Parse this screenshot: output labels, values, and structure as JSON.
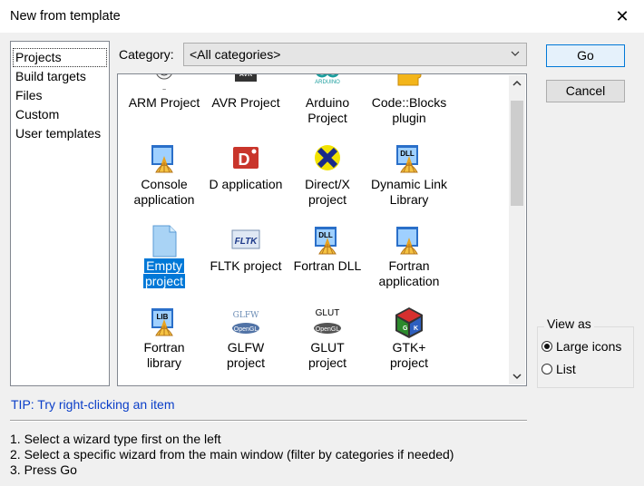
{
  "window": {
    "title": "New from template",
    "close_glyph": "✕"
  },
  "left_list": {
    "items": [
      "Projects",
      "Build targets",
      "Files",
      "Custom",
      "User templates"
    ],
    "selected_index": 0
  },
  "category": {
    "label": "Category:",
    "value": "<All categories>"
  },
  "templates": [
    {
      "label_lines": [
        "ARM Project"
      ],
      "icon": "arm-icon"
    },
    {
      "label_lines": [
        "AVR Project"
      ],
      "icon": "avr-chip-icon"
    },
    {
      "label_lines": [
        "Arduino",
        "Project"
      ],
      "icon": "arduino-icon",
      "icon_text": "ARDUINO"
    },
    {
      "label_lines": [
        "Code::Blocks",
        "plugin"
      ],
      "icon": "puzzle-icon"
    },
    {
      "label_lines": [
        "Console",
        "application"
      ],
      "icon": "console-app-icon"
    },
    {
      "label_lines": [
        "D application"
      ],
      "icon": "d-app-icon",
      "icon_text": "D"
    },
    {
      "label_lines": [
        "Direct/X",
        "project"
      ],
      "icon": "directx-icon"
    },
    {
      "label_lines": [
        "Dynamic Link",
        "Library"
      ],
      "icon": "dll-icon",
      "icon_text": "DLL"
    },
    {
      "label_lines": [
        "Empty",
        "project"
      ],
      "icon": "empty-file-icon",
      "selected": true
    },
    {
      "label_lines": [
        "FLTK project"
      ],
      "icon": "fltk-icon",
      "icon_text": "FLTK"
    },
    {
      "label_lines": [
        "Fortran DLL"
      ],
      "icon": "fortran-dll-icon",
      "icon_text": "DLL"
    },
    {
      "label_lines": [
        "Fortran",
        "application"
      ],
      "icon": "fortran-app-icon"
    },
    {
      "label_lines": [
        "Fortran",
        "library"
      ],
      "icon": "fortran-lib-icon",
      "icon_text": "LIB"
    },
    {
      "label_lines": [
        "GLFW",
        "project"
      ],
      "icon": "glfw-icon",
      "icon_text": "GLFW",
      "icon_subtext": "OpenGL"
    },
    {
      "label_lines": [
        "GLUT",
        "project"
      ],
      "icon": "glut-icon",
      "icon_text": "GLUT",
      "icon_subtext": "OpenGL"
    },
    {
      "label_lines": [
        "GTK+",
        "project"
      ],
      "icon": "gtk-icon",
      "icon_text": "GTK"
    }
  ],
  "buttons": {
    "go": "Go",
    "cancel": "Cancel"
  },
  "view_as": {
    "legend": "View as",
    "options": [
      "Large icons",
      "List"
    ],
    "selected": "Large icons"
  },
  "tip": "TIP: Try right-clicking an item",
  "steps": [
    "1. Select a wizard type first on the left",
    "2. Select a specific wizard from the main window (filter by categories if needed)",
    "3. Press Go"
  ],
  "colors": {
    "selection": "#0078d7",
    "tip_text": "#0a3ec8",
    "default_button_border": "#0078d7"
  }
}
